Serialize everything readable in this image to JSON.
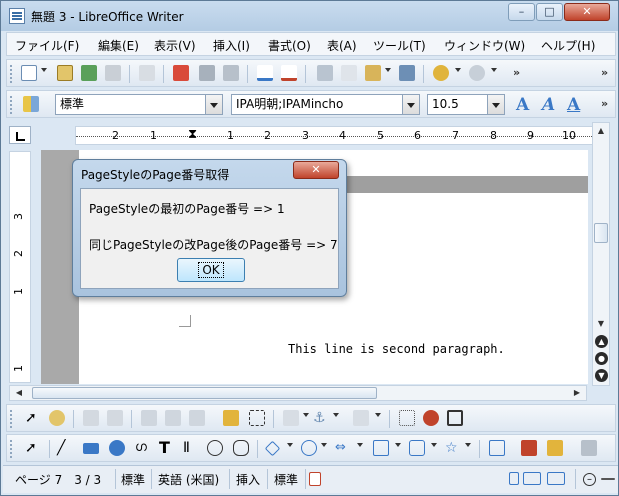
{
  "window": {
    "title": "無題 3 - LibreOffice Writer",
    "minimize": "–",
    "maximize": "□",
    "close": "✕"
  },
  "menu": [
    "ファイル(F)",
    "編集(E)",
    "表示(V)",
    "挿入(I)",
    "書式(O)",
    "表(A)",
    "ツール(T)",
    "ウィンドウ(W)",
    "ヘルプ(H)"
  ],
  "formatting": {
    "paragraph_style": "標準",
    "font_name": "IPA明朝;IPAMincho",
    "font_size": "10.5"
  },
  "ruler": {
    "labels": [
      "2",
      "1",
      "1",
      "2",
      "3",
      "4",
      "5",
      "6",
      "7",
      "8",
      "9",
      "10"
    ]
  },
  "vruler": {
    "labels": [
      "3",
      "2",
      "1",
      "1"
    ]
  },
  "document": {
    "paragraph_text": "This line is second paragraph."
  },
  "dialog": {
    "title": "PageStyleのPage番号取得",
    "line1": "PageStyleの最初のPage番号 => 1",
    "line2": "同じPageStyleの改Page後のPage番号 => 7",
    "ok_label": "OK",
    "close_label": "✕"
  },
  "statusbar": {
    "page": "ページ 7　3 / 3",
    "style": "標準",
    "language": "英語 (米国)",
    "insert_mode": "挿入",
    "selection_mode": "標準"
  },
  "colors": {
    "accent": "#3a78c6",
    "window_bg": "#dbe7f3",
    "close_red": "#c0432b"
  }
}
